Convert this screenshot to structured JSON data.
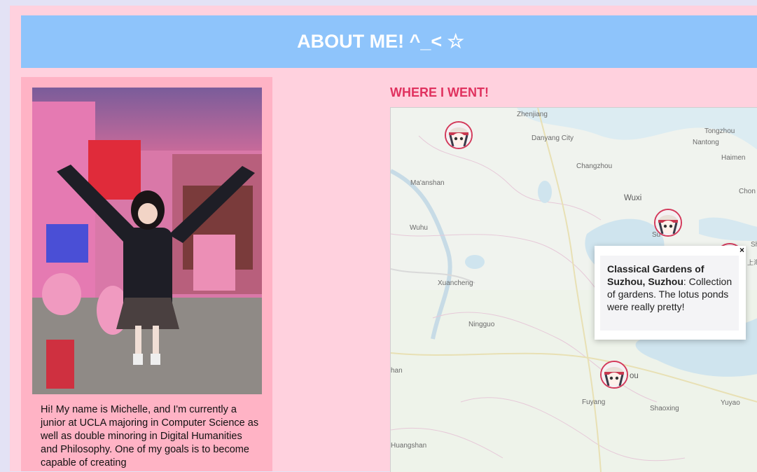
{
  "header": {
    "title": "ABOUT ME! ^_< ☆"
  },
  "bio": {
    "text": "Hi! My name is Michelle, and I'm currently a junior at UCLA majoring in Computer Science as well as double minoring in Digital Humanities and Philosophy. One of my goals is to become capable of creating"
  },
  "map_section": {
    "heading": "WHERE I WENT!"
  },
  "map": {
    "cities": [
      "Zhenjiang",
      "Danyang City",
      "Changzhou",
      "Tongzhou",
      "Nantong",
      "Haimen",
      "Chon",
      "Ma'anshan",
      "Wuxi",
      "Wuhu",
      "Su",
      "Sh",
      "上海",
      "Xuancheng",
      "Ningguo",
      "han",
      "ou",
      "Fuyang",
      "Shaoxing",
      "Yuyao",
      "Huangshan"
    ],
    "popup": {
      "title": "Classical Gardens of Suzhou, Suzhou",
      "separator": ":",
      "description": "Collection of gardens. The lotus ponds were really pretty!",
      "close": "×"
    }
  },
  "colors": {
    "background": "#e3e2f5",
    "page": "#ffd1de",
    "header": "#8ec4fb",
    "left_column": "#ffb3c5",
    "heading_accent": "#e0325f",
    "marker_border": "#d33a5b"
  },
  "icons": {
    "marker": "avatar-marker-icon",
    "close": "close-icon"
  }
}
